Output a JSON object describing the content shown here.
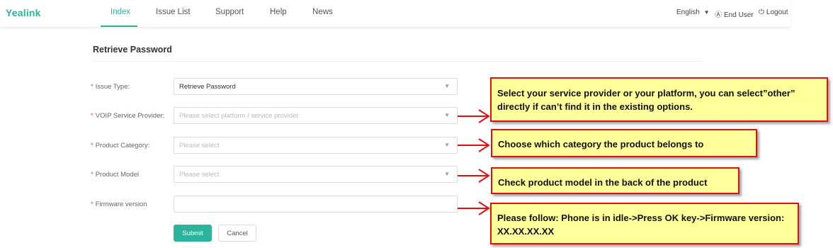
{
  "header": {
    "logo": "Yealink",
    "nav": [
      "Index",
      "Issue List",
      "Support",
      "Help",
      "News"
    ],
    "active_nav": "Index",
    "language": "English",
    "end_user": "End User",
    "logout": "Logout"
  },
  "form": {
    "title": "Retrieve Password",
    "required_mark": "*",
    "fields": [
      {
        "label": "Issue Type:",
        "value": "Retrieve Password",
        "placeholder": ""
      },
      {
        "label": "VOIP Service Provider:",
        "value": "",
        "placeholder": "Please select platform / service provider"
      },
      {
        "label": "Product Category:",
        "value": "",
        "placeholder": "Please select"
      },
      {
        "label": "Product Model",
        "value": "",
        "placeholder": "Please select"
      },
      {
        "label": "Firmware version",
        "value": "",
        "placeholder": ""
      }
    ],
    "submit_label": "Submit",
    "cancel_label": "Cancel"
  },
  "annotations": [
    "Select your service provider or your platform, you can select”other” directly if can’t find it in the existing options.",
    "Choose which category the product belongs to",
    "Check product model in the back of the product",
    "Please follow: Phone is in idle->Press OK key->Firmware version: XX.XX.XX.XX"
  ],
  "colors": {
    "brand": "#2bb39c",
    "annotation_bg": "#ffff99",
    "annotation_border": "#e01010"
  },
  "icons": [
    "caret-down-icon",
    "user-circle-icon",
    "power-icon",
    "red-arrow-icon"
  ]
}
